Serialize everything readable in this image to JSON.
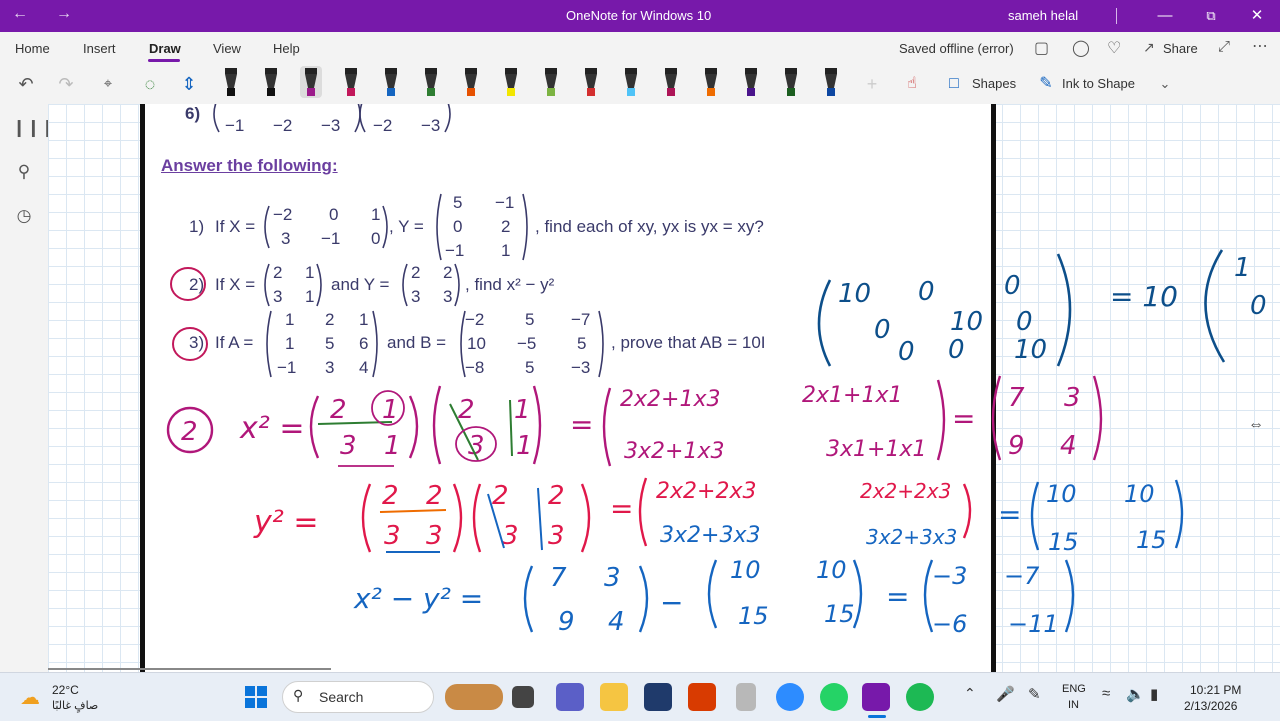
{
  "window": {
    "title": "OneNote for Windows 10",
    "user": "sameh helal",
    "back_icon": "back-arrow-icon",
    "forward_icon": "forward-arrow-icon"
  },
  "menu": {
    "items": [
      "Home",
      "Insert",
      "Draw",
      "View",
      "Help"
    ],
    "active": "Draw",
    "status": "Saved offline (error)",
    "share": "Share"
  },
  "toolbar": {
    "shapes_label": "Shapes",
    "ink_to_shape_label": "Ink to Shape",
    "pen_colors": [
      "#111111",
      "#111111",
      "#9b1b8a",
      "#c2185b",
      "#1565c0",
      "#2e7d32",
      "#e65100",
      "#f2e600",
      "#7cb342",
      "#d32f2f",
      "#4fc3f7",
      "#ad1457",
      "#ef6c00",
      "#4a148c",
      "#1b5e20",
      "#0d47a1"
    ]
  },
  "document": {
    "q6_label": "6)",
    "q6_row": [
      "−1",
      "−2",
      "−3",
      "−2",
      "−3"
    ],
    "heading": "Answer the following:",
    "q1": {
      "num": "1)",
      "if": "If X =",
      "x": [
        [
          "−2",
          "0",
          "1"
        ],
        [
          "3",
          "−1",
          "0"
        ]
      ],
      "y_label": ", Y =",
      "y": [
        [
          "5",
          "−1"
        ],
        [
          "0",
          "2"
        ],
        [
          "−1",
          "1"
        ]
      ],
      "tail": ", find each of xy, yx is yx = xy?"
    },
    "q2": {
      "num": "2)",
      "if": "If X =",
      "x": [
        [
          "2",
          "1"
        ],
        [
          "3",
          "1"
        ]
      ],
      "and": "and Y =",
      "y": [
        [
          "2",
          "2"
        ],
        [
          "3",
          "3"
        ]
      ],
      "tail": ", find x² − y²"
    },
    "q3": {
      "num": "3)",
      "if": "If A =",
      "a": [
        [
          "1",
          "2",
          "1"
        ],
        [
          "1",
          "5",
          "6"
        ],
        [
          "−1",
          "3",
          "4"
        ]
      ],
      "and": "and B =",
      "b": [
        [
          "−2",
          "5",
          "−7"
        ],
        [
          "10",
          "−5",
          "5"
        ],
        [
          "−8",
          "5",
          "−3"
        ]
      ],
      "tail": ", prove that AB = 10I"
    }
  },
  "handwriting": {
    "circled": "2",
    "x2_lhs": "x² =",
    "x2_m1": [
      [
        "2",
        "1"
      ],
      [
        "3",
        "1"
      ]
    ],
    "x2_m2": [
      [
        "2",
        "1"
      ],
      [
        "3",
        "1"
      ]
    ],
    "x2_expand": [
      [
        "2x2+1x3",
        "2x1+1x1"
      ],
      [
        "3x2+1x3",
        "3x1+1x1"
      ]
    ],
    "x2_result": [
      [
        "7",
        "3"
      ],
      [
        "9",
        "4"
      ]
    ],
    "y2_lhs": "y² =",
    "y2_m1": [
      [
        "2",
        "2"
      ],
      [
        "3",
        "3"
      ]
    ],
    "y2_m2": [
      [
        "2",
        "2"
      ],
      [
        "3",
        "3"
      ]
    ],
    "y2_expand": [
      [
        "2x2+2x3",
        "2x2+2x3"
      ],
      [
        "3x2+3x3",
        "3x2+3x3"
      ]
    ],
    "y2_result": [
      [
        "10",
        "10"
      ],
      [
        "15",
        "15"
      ]
    ],
    "diff_lhs": "x² − y² =",
    "diff_m1": [
      [
        "7",
        "3"
      ],
      [
        "9",
        "4"
      ]
    ],
    "minus": "−",
    "diff_m2": [
      [
        "10",
        "10"
      ],
      [
        "15",
        "15"
      ]
    ],
    "diff_eq": "=",
    "diff_result": [
      [
        "−3",
        "−7"
      ],
      [
        "−6",
        "−11"
      ]
    ],
    "ten_i": [
      [
        "10",
        "0",
        "0"
      ],
      [
        "0",
        "10",
        "0"
      ],
      [
        "0",
        "0",
        "10"
      ]
    ],
    "ten_i_eq": "= 10",
    "ten_i_partial": [
      [
        "1"
      ],
      [
        "0"
      ]
    ]
  },
  "taskbar": {
    "weather_temp": "22°C",
    "weather_desc": "صافٍ غالبًا",
    "search": "Search",
    "lang_top": "ENG",
    "lang_bottom": "IN",
    "time": "10:21 PM",
    "date": "2/13/2026"
  }
}
